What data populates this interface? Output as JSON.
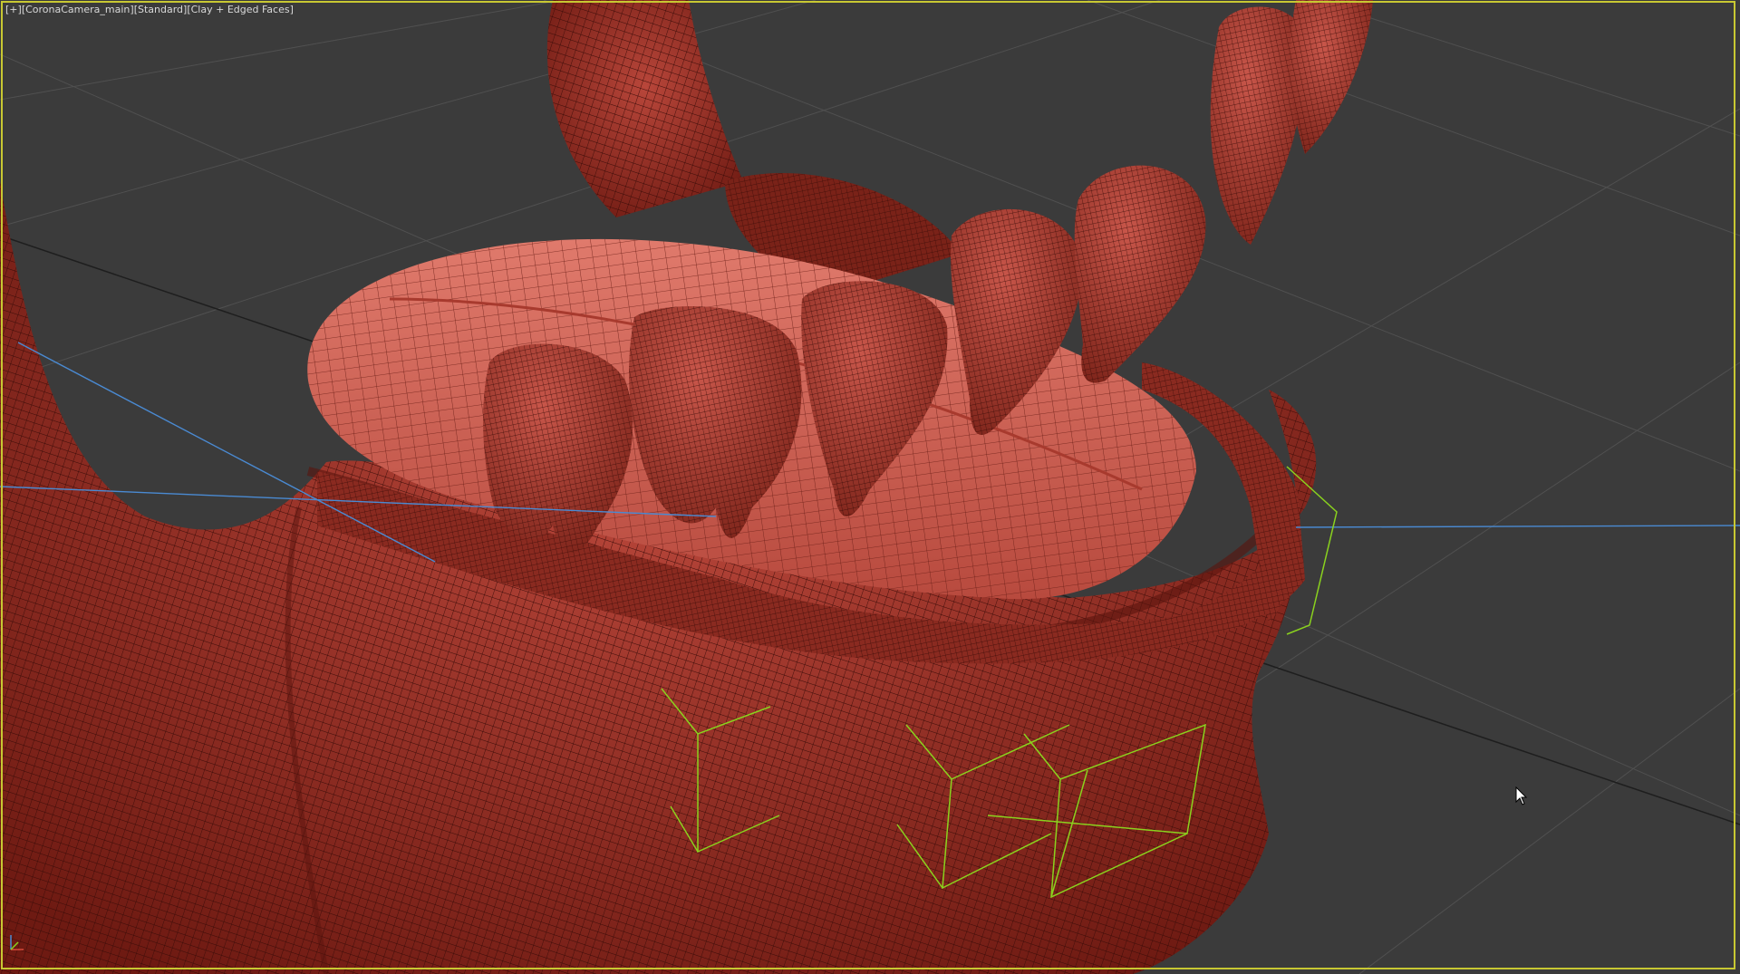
{
  "viewport": {
    "label_parts": [
      "[+]",
      " [CoronaCamera_main]",
      " [Standard]",
      " [Clay + Edged Faces]"
    ],
    "scene_description_icon": "3d-jaw-model",
    "colors": {
      "background": "#3b3b3b",
      "grid": "#505050",
      "mesh": "#9a2e24",
      "mesh_light": "#c8564a",
      "wire": "#3a0c08",
      "helper_green": "#8ad21e",
      "helper_blue": "#4a8ad2",
      "active_border": "#c8c832"
    }
  },
  "gizmo": {
    "icon": "axis-tripod-icon"
  },
  "cursor": {
    "icon": "mouse-pointer-icon"
  }
}
